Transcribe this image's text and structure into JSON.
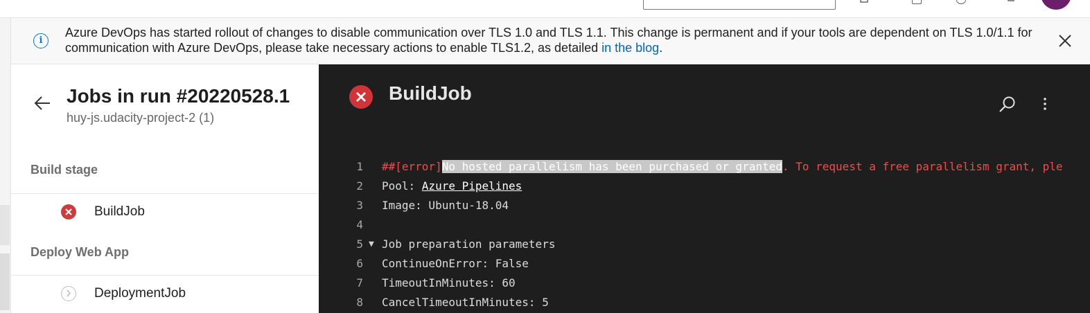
{
  "banner": {
    "text_before": "Azure DevOps has started rollout of changes to disable communication over TLS 1.0 and TLS 1.1. This change is permanent and if your tools are dependent on TLS 1.0/1.1 for communication with Azure DevOps, please take necessary actions to enable TLS1.2, as detailed ",
    "link_text": "in the blog",
    "text_after": ".",
    "info_icon_glyph": "i",
    "accent_color": "#0078d4"
  },
  "run": {
    "title": "Jobs in run #20220528.1",
    "subtitle": "huy-js.udacity-project-2 (1)"
  },
  "stages": [
    {
      "name": "Build stage",
      "jobs": [
        {
          "name": "BuildJob",
          "status": "failed"
        }
      ]
    },
    {
      "name": "Deploy Web App",
      "jobs": [
        {
          "name": "DeploymentJob",
          "status": "pending"
        }
      ]
    }
  ],
  "log": {
    "title": "BuildJob",
    "status": "failed",
    "lines": [
      {
        "number": "1",
        "prefix": "##[error]",
        "highlight": "No hosted parallelism has been purchased or granted",
        "suffix": ". To request a free parallelism grant, ple"
      },
      {
        "number": "2",
        "label": "Pool: ",
        "link": "Azure Pipelines"
      },
      {
        "number": "3",
        "text": "Image: Ubuntu-18.04"
      },
      {
        "number": "4",
        "text": ""
      },
      {
        "number": "5",
        "toggle": "▼",
        "text": "Job preparation parameters"
      },
      {
        "number": "6",
        "text": "ContinueOnError: False"
      },
      {
        "number": "7",
        "text": "TimeoutInMinutes: 60"
      },
      {
        "number": "8",
        "text": "CancelTimeoutInMinutes: 5"
      }
    ]
  },
  "colors": {
    "failed": "#cd3c3c",
    "error_text": "#f14c4c",
    "log_background": "#1e1e1e",
    "avatar": "#6b1f6b"
  }
}
